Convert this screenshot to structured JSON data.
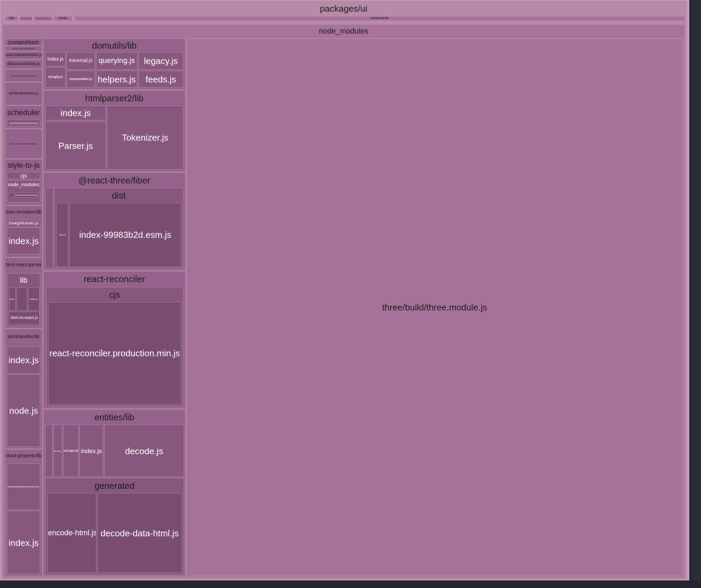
{
  "root": {
    "title": "packages/ui",
    "top_strip": {
      "utils": "utils",
      "constants": "constants.ts",
      "useSomething": "useAsyncState.ts",
      "hooks": "hooks",
      "components": "components"
    }
  },
  "node_modules": {
    "title": "node_modules",
    "left_col": {
      "zustand": "zustand/esm",
      "html_dom_parser": "html-dom-parser/lib/server",
      "classnames": "classnames/index.js",
      "debounce": "debounce/index.js",
      "domelementtype": "domelementtype/lib/index.js",
      "its_fine": "its-fine/dist/index.js",
      "scheduler": "scheduler",
      "scheduler_file": "cjs/scheduler.production.min.js",
      "react_use_measure": "react-use-measure/dist/web.js",
      "style_to_js": "style-to-js",
      "style_cjs": "cjs",
      "style_node_modules": "node_modules",
      "inline_style_parser": "inline-style-parser/index.js",
      "dom_serializer": "dom-serializer/lib",
      "foreign_names": "foreignNames.js",
      "dom_serializer_index": "index.js",
      "html_react_parser": "html-react-parser",
      "hrp_lib": "lib",
      "hrp_a": "index.js",
      "hrp_utilities": "utilities.js",
      "dom_to_react": "dom-to-react.js",
      "domhandler": "domhandler/lib",
      "domhandler_index": "index.js",
      "domhandler_node": "node.js",
      "react_property": "react-property/lib",
      "possible_standard": "possibleStandardNamesOptimized.js",
      "react_property_index": "index.js"
    },
    "domutils": {
      "title": "domutils/lib",
      "files": {
        "index": "index.js",
        "traversal": "traversal.js",
        "querying": "querying.js",
        "legacy": "legacy.js",
        "stringify": "stringify.js",
        "manipulation": "manipulation.js",
        "helpers": "helpers.js",
        "feeds": "feeds.js"
      }
    },
    "htmlparser2": {
      "title": "htmlparser2/lib",
      "index": "index.js",
      "parser": "Parser.js",
      "tokenizer": "Tokenizer.js"
    },
    "react_three_fiber": {
      "title": "@react-three/fiber",
      "dist": "dist",
      "small": "index.js",
      "main": "index-99983b2d.esm.js"
    },
    "react_reconciler": {
      "title": "react-reconciler",
      "cjs": "cjs",
      "file": "react-reconciler.production.min.js"
    },
    "entities": {
      "title": "entities/lib",
      "decode_codepoint": "decode_codepoint.js",
      "escape": "escape.js",
      "index": "index.js",
      "decode": "decode.js",
      "generated": "generated",
      "encode_html": "encode-html.js",
      "decode_data_html": "decode-data-html.js"
    },
    "three": {
      "file": "three/build/three.module.js"
    }
  }
}
